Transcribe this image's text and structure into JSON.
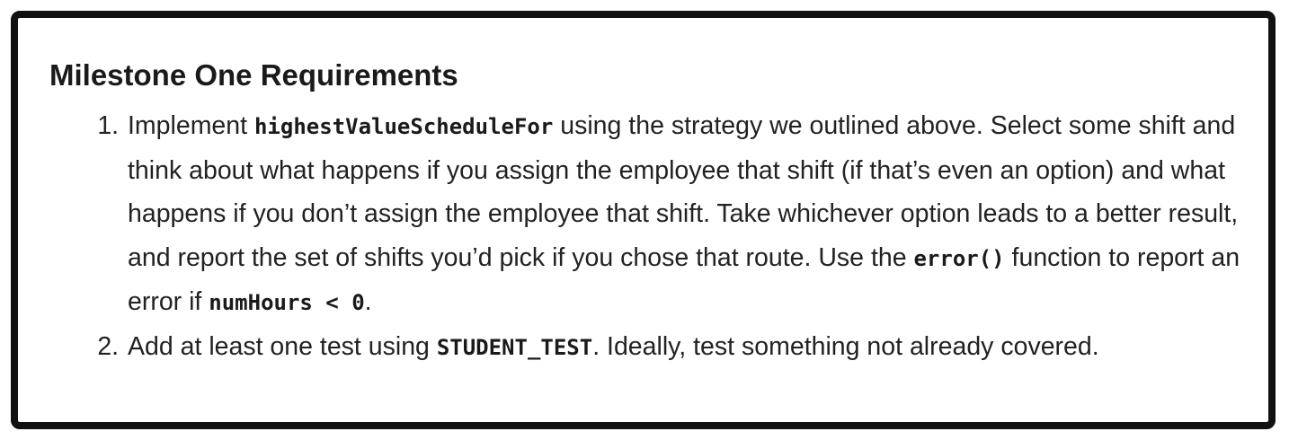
{
  "heading": "Milestone One Requirements",
  "requirements": [
    {
      "before": "Implement ",
      "code1": "highestValueScheduleFor",
      "middle": " using the strategy we outlined above. Select some shift and think about what happens if you assign the employee that shift (if that’s even an option) and what happens if you don’t assign the employee that shift. Take whichever option leads to a better result, and report the set of shifts you’d pick if you chose that route. Use the ",
      "code2": "error()",
      "middle2": " function to report an error if ",
      "code3": "numHours < 0",
      "after": "."
    },
    {
      "before": "Add at least one test using ",
      "code1": "STUDENT_TEST",
      "after": ". Ideally, test something not already covered."
    }
  ]
}
